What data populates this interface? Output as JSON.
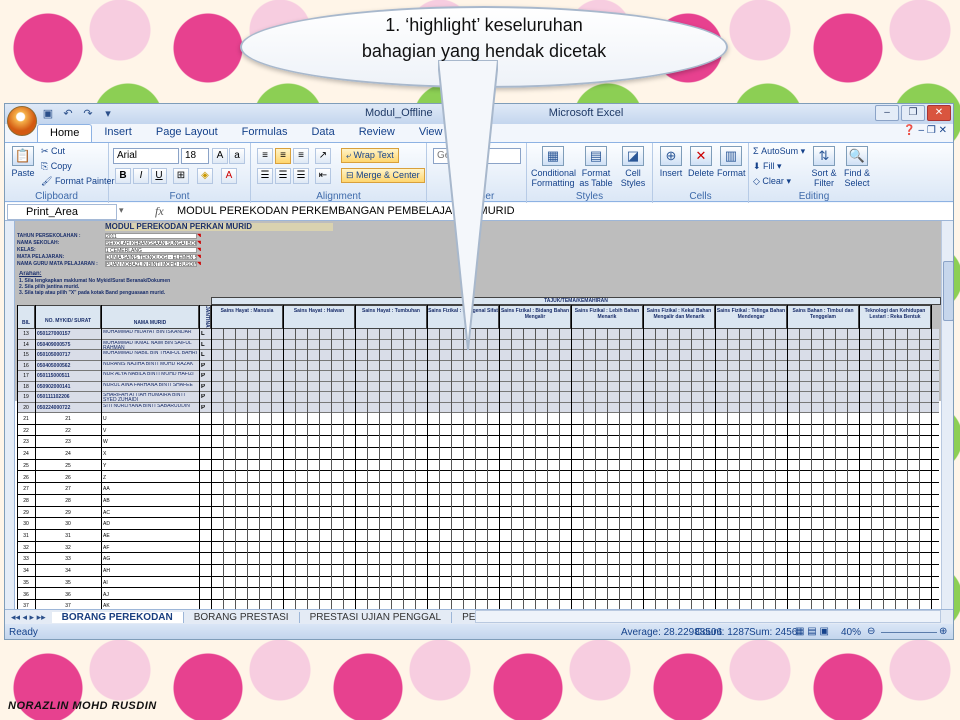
{
  "callout": {
    "line1": "1. ‘highlight’ keseluruhan",
    "line2": "bahagian yang hendak dicetak"
  },
  "window": {
    "title_left": "Modul_Offline",
    "title_right": "Microsoft Excel"
  },
  "ribbon_tabs": [
    "Home",
    "Insert",
    "Page Layout",
    "Formulas",
    "Data",
    "Review",
    "View"
  ],
  "ribbon": {
    "clipboard": {
      "paste": "Paste",
      "cut": "Cut",
      "copy": "Copy",
      "format_painter": "Format Painter",
      "label": "Clipboard"
    },
    "font": {
      "name": "Arial",
      "size": "18",
      "label": "Font",
      "bold": "B",
      "italic": "I",
      "underline": "U"
    },
    "alignment": {
      "wrap": "Wrap Text",
      "merge": "Merge & Center",
      "label": "Alignment"
    },
    "number": {
      "format": "General",
      "label": "Number"
    },
    "styles": {
      "conditional_line1": "Conditional",
      "conditional_line2": "Formatting",
      "format_table_line1": "Format",
      "format_table_line2": "as Table",
      "cell_styles_line1": "Cell",
      "cell_styles_line2": "Styles",
      "label": "Styles"
    },
    "cells": {
      "insert": "Insert",
      "delete": "Delete",
      "format": "Format",
      "label": "Cells"
    },
    "editing": {
      "autosum": "AutoSum",
      "fill": "Fill",
      "clear": "Clear",
      "sort_line1": "Sort &",
      "sort_line2": "Filter",
      "find_line1": "Find &",
      "find_line2": "Select",
      "label": "Editing"
    }
  },
  "formula_bar": {
    "name_box": "Print_Area",
    "fx": "fx",
    "content": "MODUL PEREKODAN PERKEMBANGAN PEMBELAJARAN MURID"
  },
  "sheet": {
    "title": "MODUL PEREKODAN PERKAN MURID",
    "info_labels": [
      "TAHUN PERSEKOLAHAN :",
      "NAMA SEKOLAH:",
      "KELAS:",
      "MATA PELAJARAN:",
      "NAMA GURU MATA PELAJARAN :"
    ],
    "info_values": [
      "2011",
      "SEKOLAH KEBANGSAAN SUNGAI BOKAH",
      "1 CEMERLANG",
      "DUNIA SAINS TEKNOLOGI - ELEMEN SAINS TAHUN 1",
      "PUAN NORAZLIN BINTI MOHD RUSDIN"
    ],
    "arahan_title": "Arahan:",
    "arahan": [
      "1. Sila lengkapkan maklumat No Mykid/Surat Beranak/Dokumen",
      "2. Sila pilih jantina murid.",
      "3. Sila taip atau pilih \"X\" pada kotak Band penguasaan murid."
    ],
    "col_bil": "BIL",
    "col_no": "NO. MYKID/ SURAT",
    "col_nama": "NAMA MURID",
    "col_jantina": "JANTINA",
    "tajuk": "TAJUK/TEMA/KEMAHIRAN",
    "topics": [
      "Sains Hayat : Manusia",
      "Sains Hayat : Haiwan",
      "Sains Hayat : Tumbuhan",
      "Sains Fizikal : Mengenal Sifat",
      "Sains Fizikal : Bidang Bahan Mengalir",
      "Sains Fizikal : Lebih Bahan Menarik",
      "Sains Fizikal : Kekal Bahan Mengalir dan Menarik",
      "Sains Fizikal : Telinga Bahan Mendengar",
      "Sains Bahan : Timbul dan Tenggelam",
      "Teknologi dan Kehidupan Lestari : Reka Bentuk"
    ],
    "students": [
      {
        "bil": "13",
        "no": "050127000157",
        "nama": "MUHAMMAD HIDAYAT BIN ISKANDAR",
        "j": "L"
      },
      {
        "bil": "14",
        "no": "050409000575",
        "nama": "MUHAMMAD IKMAL NAIM BIN SAIFUL RAHMAN",
        "j": "L"
      },
      {
        "bil": "15",
        "no": "050105000717",
        "nama": "MUHAMMAD NABIL BIN THAIFUL BAHRI",
        "j": "L"
      },
      {
        "bil": "16",
        "no": "050405000562",
        "nama": "NURANIS NAJIHA BINTI MOHD RAZAK",
        "j": "P"
      },
      {
        "bil": "17",
        "no": "050115000511",
        "nama": "NUR ALYA NABILA BINTI MOHD HAFIZI",
        "j": "P"
      },
      {
        "bil": "18",
        "no": "050902000141",
        "nama": "NURUL AINA FARHANA BINTI SHAFEE",
        "j": "P"
      },
      {
        "bil": "19",
        "no": "050111102206",
        "nama": "SHARIFAH ATTIAH HUMAIRA BINTI SYED ZUHAIDI",
        "j": "P"
      },
      {
        "bil": "20",
        "no": "050224000722",
        "nama": "SITI NURLIYANA BINTI SABARUDDIN",
        "j": "P"
      }
    ],
    "empty_rows": [
      {
        "bil": "21",
        "no": "21",
        "c": "U"
      },
      {
        "bil": "22",
        "no": "22",
        "c": "V"
      },
      {
        "bil": "23",
        "no": "23",
        "c": "W"
      },
      {
        "bil": "24",
        "no": "24",
        "c": "X"
      },
      {
        "bil": "25",
        "no": "25",
        "c": "Y"
      },
      {
        "bil": "26",
        "no": "26",
        "c": "Z"
      },
      {
        "bil": "27",
        "no": "27",
        "c": "AA"
      },
      {
        "bil": "28",
        "no": "28",
        "c": "AB"
      },
      {
        "bil": "29",
        "no": "29",
        "c": "AC"
      },
      {
        "bil": "30",
        "no": "30",
        "c": "AD"
      },
      {
        "bil": "31",
        "no": "31",
        "c": "AE"
      },
      {
        "bil": "32",
        "no": "32",
        "c": "AF"
      },
      {
        "bil": "33",
        "no": "33",
        "c": "AG"
      },
      {
        "bil": "34",
        "no": "34",
        "c": "AH"
      },
      {
        "bil": "35",
        "no": "35",
        "c": "AI"
      },
      {
        "bil": "36",
        "no": "36",
        "c": "AJ"
      },
      {
        "bil": "37",
        "no": "37",
        "c": "AK"
      }
    ]
  },
  "sheet_tabs": [
    "BORANG PEREKODAN",
    "BORANG PRESTASI",
    "PRESTASI UJIAN PENGGAL",
    "PELAPORAN MURID"
  ],
  "status": {
    "ready": "Ready",
    "average": "Average: 28.22988506",
    "count": "Count: 1287",
    "sum": "Sum: 2456",
    "zoom": "40%"
  },
  "footer": "NORAZLIN MOHD RUSDIN"
}
